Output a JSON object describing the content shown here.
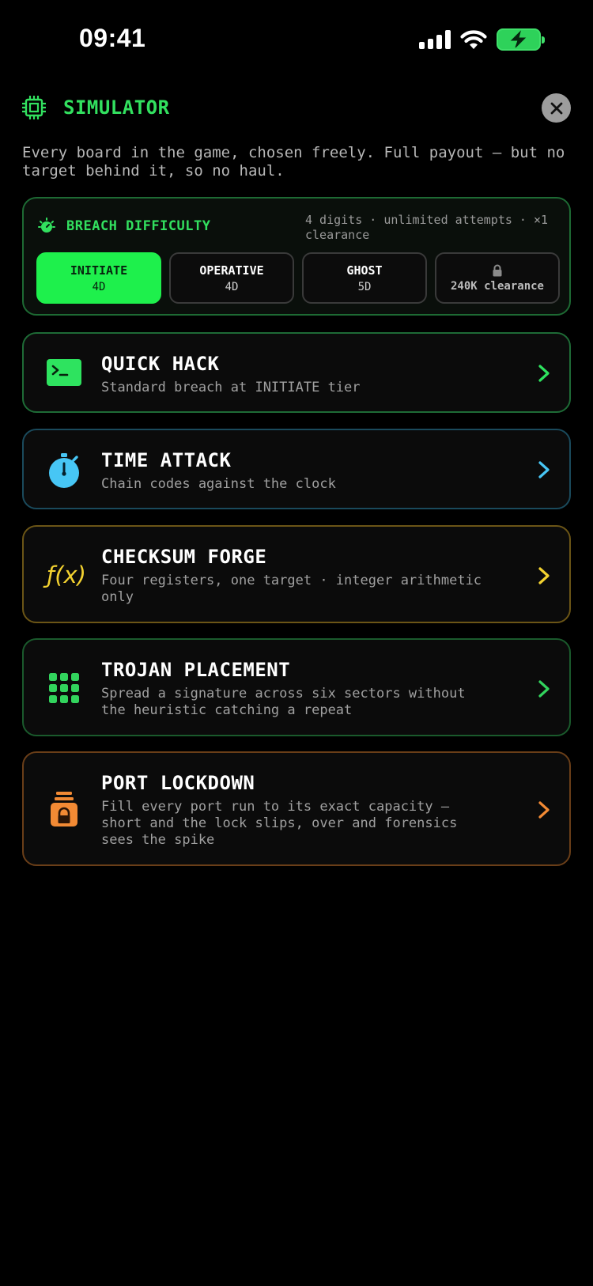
{
  "status": {
    "time": "09:41"
  },
  "header": {
    "title": "SIMULATOR",
    "intro": "Every board in the game, chosen freely. Full payout — but no target behind it, so no haul."
  },
  "difficulty": {
    "title": "BREACH DIFFICULTY",
    "meta": "4 digits · unlimited attempts · ×1 clearance",
    "tiers": [
      {
        "name": "INITIATE",
        "digits": "4D",
        "selected": true
      },
      {
        "name": "OPERATIVE",
        "digits": "4D"
      },
      {
        "name": "GHOST",
        "digits": "5D"
      },
      {
        "name": "lock-icon",
        "digits": "240K clearance",
        "locked": true
      }
    ]
  },
  "modes": [
    {
      "title": "QUICK HACK",
      "desc": "Standard breach at INITIATE tier",
      "color": "#2ee35f",
      "icon": "terminal-icon"
    },
    {
      "title": "TIME ATTACK",
      "desc": "Chain codes against the clock",
      "color": "#47c6f5",
      "icon": "stopwatch-icon"
    },
    {
      "title": "CHECKSUM FORGE",
      "desc": "Four registers, one target · integer arithmetic only",
      "color": "#f3d230",
      "icon": "function-icon",
      "icon_text": "ƒ(x)"
    },
    {
      "title": "TROJAN PLACEMENT",
      "desc": "Spread a signature across six sectors without the heuristic catching a repeat",
      "color": "#32d45d",
      "icon": "grid-icon"
    },
    {
      "title": "PORT LOCKDOWN",
      "desc": "Fill every port run to its exact capacity — short and the lock slips, over and forensics sees the spike",
      "color": "#f28a34",
      "icon": "padlock-icon"
    }
  ]
}
